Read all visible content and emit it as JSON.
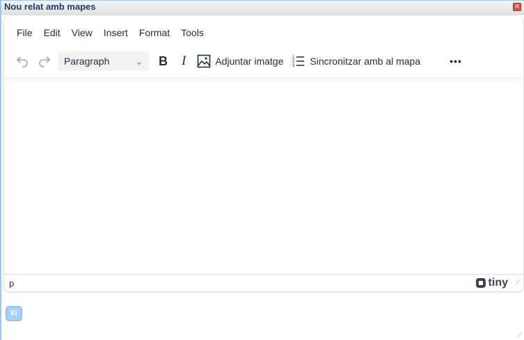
{
  "window": {
    "title": "Nou relat amb mapes"
  },
  "menubar": [
    "File",
    "Edit",
    "View",
    "Insert",
    "Format",
    "Tools"
  ],
  "toolbar": {
    "block_format": "Paragraph",
    "attach_image": "Adjuntar imatge",
    "sync_map": "Sincronitzar amb al mapa"
  },
  "statusbar": {
    "path": "p",
    "brand": "tiny"
  },
  "footer": {
    "fi_button": "Fi"
  }
}
